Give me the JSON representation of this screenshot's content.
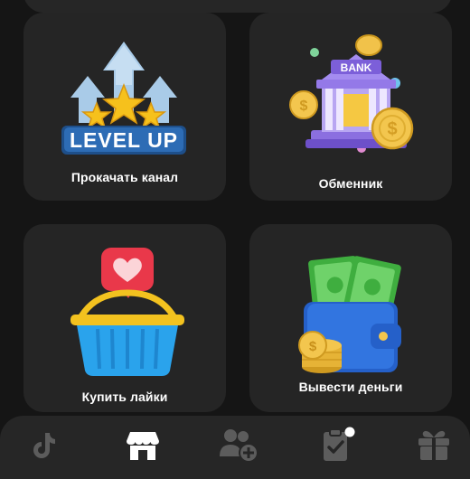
{
  "cards": [
    {
      "id": "levelup",
      "label": "Прокачать канал",
      "badge_text": "LEVEL UP"
    },
    {
      "id": "exchange",
      "label": "Обменник",
      "bank_sign": "BANK"
    },
    {
      "id": "likes",
      "label": "Купить лайки"
    },
    {
      "id": "withdraw",
      "label": "Вывести деньги"
    }
  ],
  "nav": {
    "items": [
      {
        "icon": "tiktok-icon",
        "active": false
      },
      {
        "icon": "shop-icon",
        "active": true
      },
      {
        "icon": "add-users-icon",
        "active": false
      },
      {
        "icon": "tasks-clipboard-icon",
        "active": false,
        "has_dot": true
      },
      {
        "icon": "gift-icon",
        "active": false
      }
    ]
  },
  "colors": {
    "background": "#151515",
    "card": "#252525",
    "nav_bg": "#262626",
    "nav_icon_inactive": "#5c5c5c",
    "nav_icon_active": "#ffffff"
  }
}
